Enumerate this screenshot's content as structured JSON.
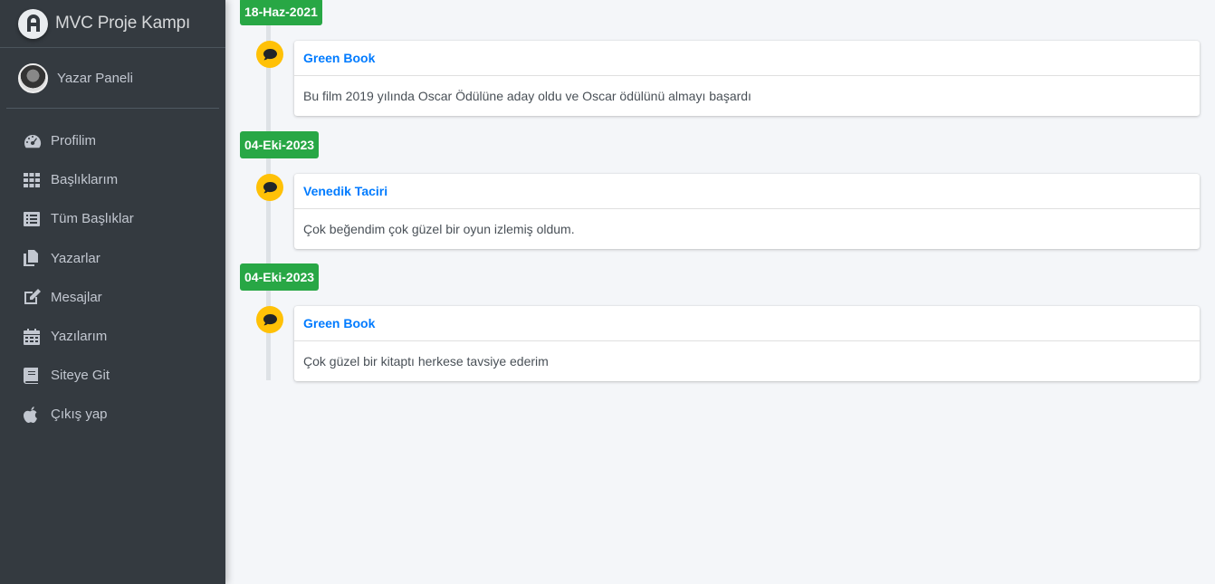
{
  "brand": {
    "title": "MVC Proje Kampı"
  },
  "user": {
    "name": "Yazar Paneli"
  },
  "nav": [
    {
      "label": "Profilim",
      "icon": "dashboard-icon"
    },
    {
      "label": "Başlıklarım",
      "icon": "grid-icon"
    },
    {
      "label": "Tüm Başlıklar",
      "icon": "list-icon"
    },
    {
      "label": "Yazarlar",
      "icon": "copy-icon"
    },
    {
      "label": "Mesajlar",
      "icon": "edit-icon"
    },
    {
      "label": "Yazılarım",
      "icon": "calendar-icon"
    },
    {
      "label": "Siteye Git",
      "icon": "book-icon"
    },
    {
      "label": "Çıkış yap",
      "icon": "apple-icon"
    }
  ],
  "timeline": [
    {
      "date": "18-Haz-2021",
      "title": "Green Book",
      "body": "Bu film 2019 yılında Oscar Ödülüne aday oldu ve Oscar ödülünü almayı başardı"
    },
    {
      "date": "04-Eki-2023",
      "title": "Venedik Taciri",
      "body": "Çok beğendim çok güzel bir oyun izlemiş oldum."
    },
    {
      "date": "04-Eki-2023",
      "title": "Green Book",
      "body": "Çok güzel bir kitaptı herkese tavsiye ederim"
    }
  ],
  "colors": {
    "sidebar": "#343a40",
    "label": "#28a745",
    "icon": "#ffc107",
    "link": "#007bff"
  }
}
